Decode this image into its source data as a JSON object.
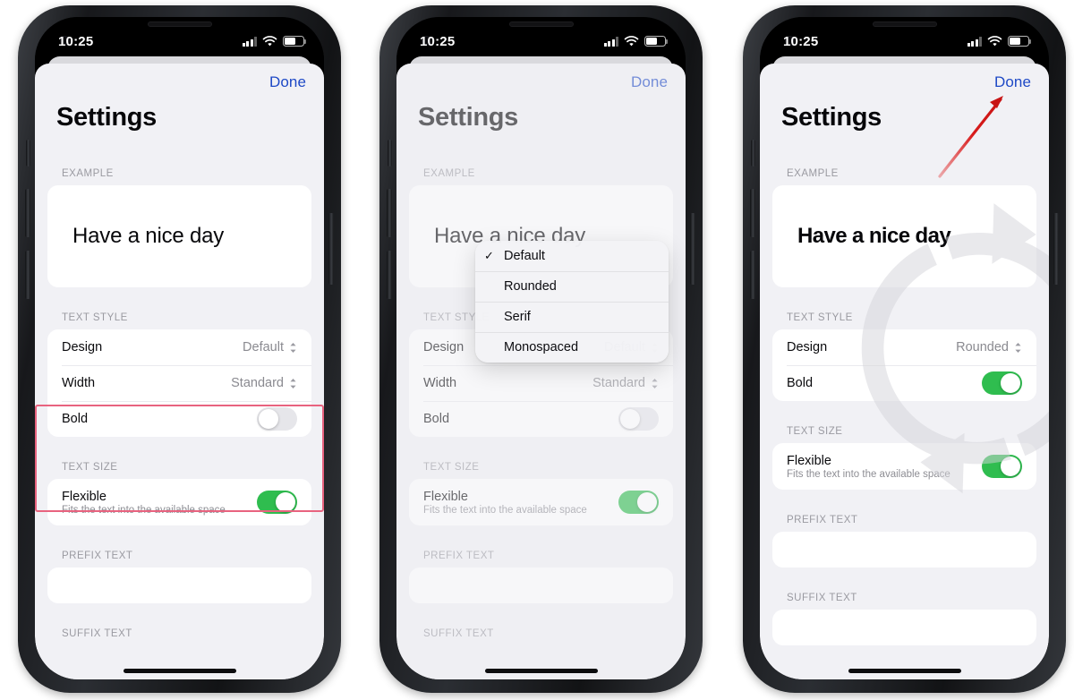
{
  "colors": {
    "accent_blue": "#1e49c6",
    "toggle_green": "#2fbd4f",
    "highlight_red": "#e8637f",
    "arrow_red": "#e02020",
    "sheet_bg": "#f1f1f5",
    "card_bg": "#ffffff",
    "label_gray": "#9a9aa1"
  },
  "status_bar": {
    "time": "10:25",
    "icons": [
      "cellular-signal-icon",
      "wifi-icon",
      "battery-icon"
    ]
  },
  "nav": {
    "done_label": "Done"
  },
  "page_title": "Settings",
  "sections": {
    "example_label": "EXAMPLE",
    "example_text": "Have a nice day",
    "text_style_label": "TEXT STYLE",
    "text_size_label": "TEXT SIZE",
    "prefix_label": "PREFIX TEXT",
    "suffix_label": "SUFFIX TEXT"
  },
  "rows": {
    "design_label": "Design",
    "width_label": "Width",
    "bold_label": "Bold",
    "flexible_label": "Flexible",
    "flexible_sub": "Fits the text into the available space"
  },
  "phones": [
    {
      "id": "phone-1",
      "caption_state": "default",
      "design_value": "Default",
      "width_value": "Standard",
      "bold_on": false,
      "flexible_on": true,
      "has_width_row": true,
      "example_bold": false,
      "highlight": true,
      "menu_open": false,
      "watermark": false,
      "pointer": false,
      "fields": [
        "PREFIX TEXT"
      ]
    },
    {
      "id": "phone-2",
      "caption_state": "menu-open",
      "design_value": "Default",
      "width_value": "Standard",
      "bold_on": false,
      "flexible_on": true,
      "has_width_row": true,
      "example_bold": false,
      "highlight": false,
      "menu_open": true,
      "watermark": false,
      "pointer": false,
      "fields": [
        "PREFIX TEXT"
      ]
    },
    {
      "id": "phone-3",
      "caption_state": "rounded-bold",
      "design_value": "Rounded",
      "width_value": "",
      "bold_on": true,
      "flexible_on": true,
      "has_width_row": false,
      "example_bold": true,
      "highlight": false,
      "menu_open": false,
      "watermark": true,
      "pointer": true,
      "fields": [
        "PREFIX TEXT",
        "SUFFIX TEXT"
      ]
    }
  ],
  "design_menu": {
    "selected": "Default",
    "items": [
      {
        "label": "Default",
        "checked": true
      },
      {
        "label": "Rounded",
        "checked": false
      },
      {
        "label": "Serif",
        "checked": false
      },
      {
        "label": "Monospaced",
        "checked": false
      }
    ]
  },
  "annotations": {
    "pointer_target": "Done",
    "watermark_icon": "refresh-circular-arrow-icon"
  }
}
